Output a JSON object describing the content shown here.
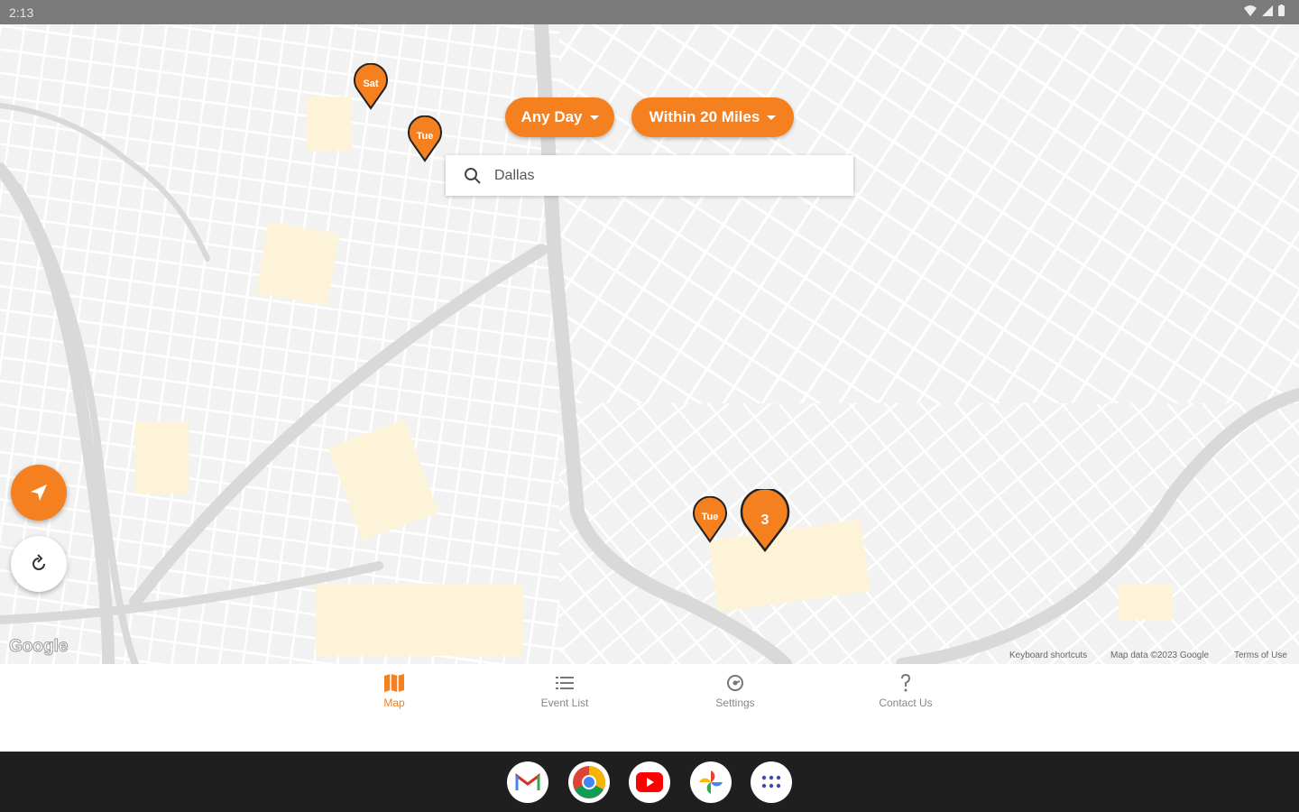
{
  "status": {
    "time": "2:13"
  },
  "filters": {
    "day": "Any Day",
    "distance": "Within 20 Miles"
  },
  "search": {
    "value": "Dallas"
  },
  "pins": [
    {
      "label": "Sat"
    },
    {
      "label": "Tue"
    },
    {
      "label": "Tue"
    },
    {
      "label": "3"
    }
  ],
  "map": {
    "logo": "Google",
    "attribution": {
      "shortcuts": "Keyboard shortcuts",
      "data": "Map data ©2023 Google",
      "terms": "Terms of Use"
    }
  },
  "nav": {
    "items": [
      {
        "label": "Map",
        "icon": "map-icon",
        "active": true
      },
      {
        "label": "Event List",
        "icon": "list-icon",
        "active": false
      },
      {
        "label": "Settings",
        "icon": "settings-icon",
        "active": false
      },
      {
        "label": "Contact Us",
        "icon": "question-icon",
        "active": false
      }
    ]
  },
  "taskbar": {
    "apps": [
      "gmail-icon",
      "chrome-icon",
      "youtube-icon",
      "photos-icon",
      "app-drawer-icon"
    ]
  },
  "colors": {
    "accent": "#f5801f",
    "map_bg": "#f2f2f2",
    "road": "#ffffff",
    "highway": "#d8d8d8",
    "park": "#fdf3d6"
  }
}
